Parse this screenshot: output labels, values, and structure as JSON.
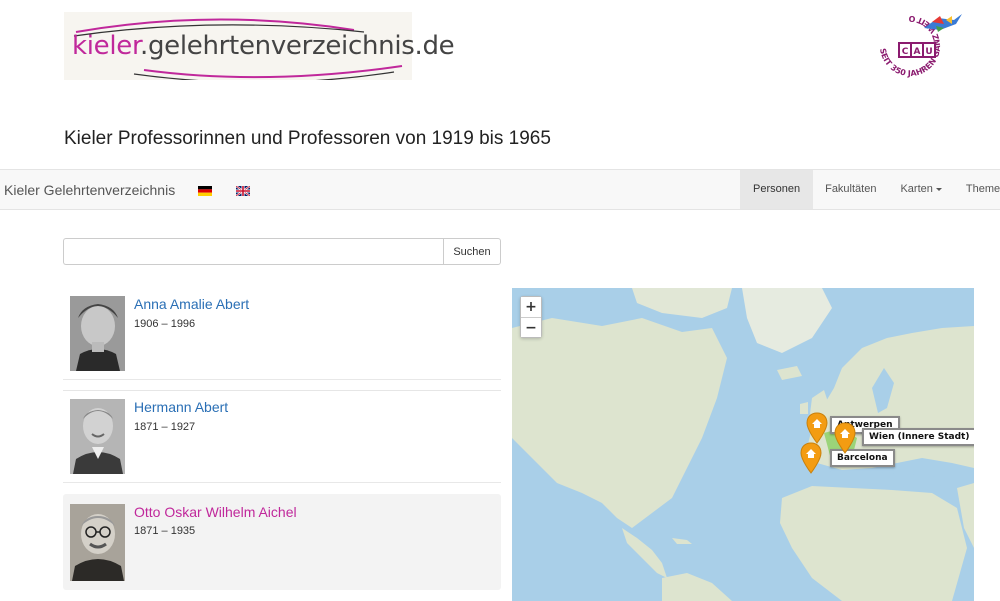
{
  "header": {
    "logo_part1": "kieler",
    "logo_part2": ".gelehrtenverzeichnis.de",
    "cau_logo_alt": "SEIT 350 JAHREN GANZ WEIT OBEN",
    "page_title": "Kieler Professorinnen und Professoren von 1919 bis 1965"
  },
  "navbar": {
    "brand": "Kieler Gelehrtenverzeichnis",
    "items": [
      {
        "label": "Personen",
        "active": true
      },
      {
        "label": "Fakultäten",
        "active": false
      },
      {
        "label": "Karten",
        "active": false
      },
      {
        "label": "Themen",
        "active": false
      }
    ]
  },
  "search": {
    "placeholder": "",
    "button_label": "Suchen"
  },
  "persons": [
    {
      "name": "Anna Amalie Abert",
      "years": "1906 – 1996"
    },
    {
      "name": "Hermann Abert",
      "years": "1871 – 1927"
    },
    {
      "name": "Otto Oskar Wilhelm Aichel",
      "years": "1871 – 1935"
    }
  ],
  "map": {
    "zoom_in": "+",
    "zoom_out": "−",
    "labels": {
      "antwerpen": "Antwerpen",
      "wien": "Wien (Innere Stadt)",
      "barcelona": "Barcelona"
    }
  },
  "colors": {
    "accent": "#c0289b",
    "link": "#2a6fb5",
    "marker": "#f39c12",
    "water": "#a9cfe8",
    "land": "#dde4cf"
  }
}
